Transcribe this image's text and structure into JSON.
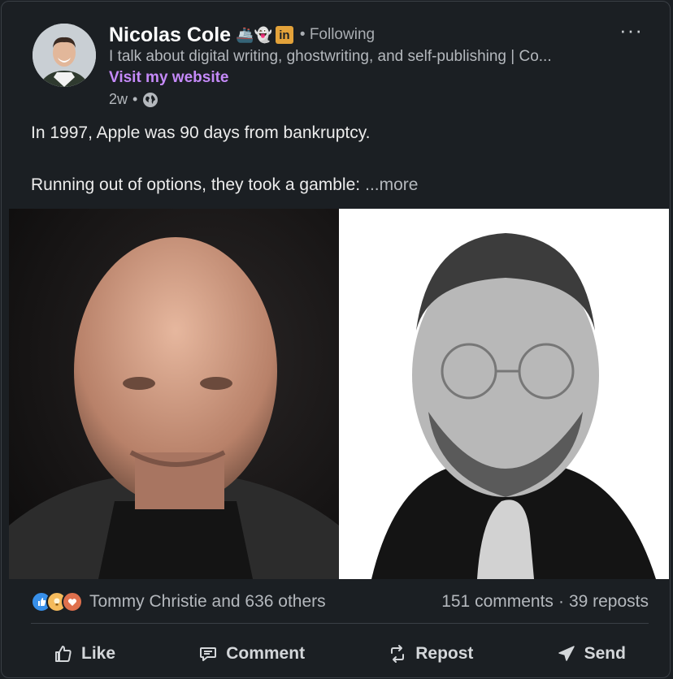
{
  "author": {
    "name": "Nicolas Cole",
    "badge_emojis": "🚢👻",
    "linkedin_badge": "in",
    "follow_status": "• Following",
    "tagline": "I talk about digital writing, ghostwriting, and self-publishing | Co...",
    "website_link": "Visit my website",
    "time_ago": "2w",
    "separator": "•",
    "visibility_icon": "globe-icon"
  },
  "menu_label": "···",
  "post": {
    "line1": "In 1997, Apple was 90 days from bankruptcy.",
    "line2": "Running out of options, they took a gamble:",
    "more_label": "...more"
  },
  "social": {
    "reactions_text": "Tommy Christie and 636 others",
    "comments": "151 comments",
    "dot": "·",
    "reposts": "39 reposts",
    "reaction_icons": [
      "like-icon",
      "insightful-icon",
      "love-icon"
    ]
  },
  "actions": {
    "like": "Like",
    "comment": "Comment",
    "repost": "Repost",
    "send": "Send"
  },
  "colors": {
    "background": "#1b1f23",
    "link_purple": "#c58af9",
    "like_blue": "#378fe9",
    "linkedin_badge_gold": "#e3a23a"
  }
}
